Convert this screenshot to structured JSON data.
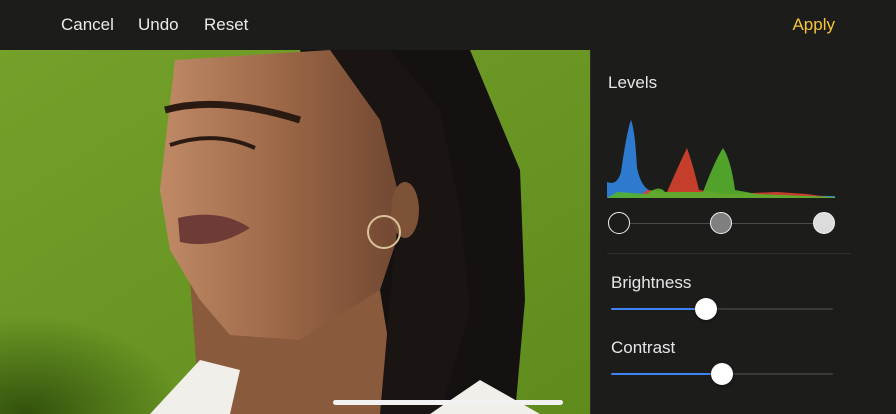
{
  "toolbar": {
    "cancel_label": "Cancel",
    "undo_label": "Undo",
    "reset_label": "Reset",
    "apply_label": "Apply"
  },
  "colors": {
    "accent": "#f5c43c",
    "slider_fill": "#3d83f5",
    "photo_background": "#6a9722",
    "panel_background": "#1c1c1b"
  },
  "panel": {
    "levels": {
      "title": "Levels",
      "black_point": 0.0,
      "midtone": 0.5,
      "white_point": 1.0
    },
    "brightness": {
      "label": "Brightness",
      "value": 0.43
    },
    "contrast": {
      "label": "Contrast",
      "value": 0.5
    }
  }
}
